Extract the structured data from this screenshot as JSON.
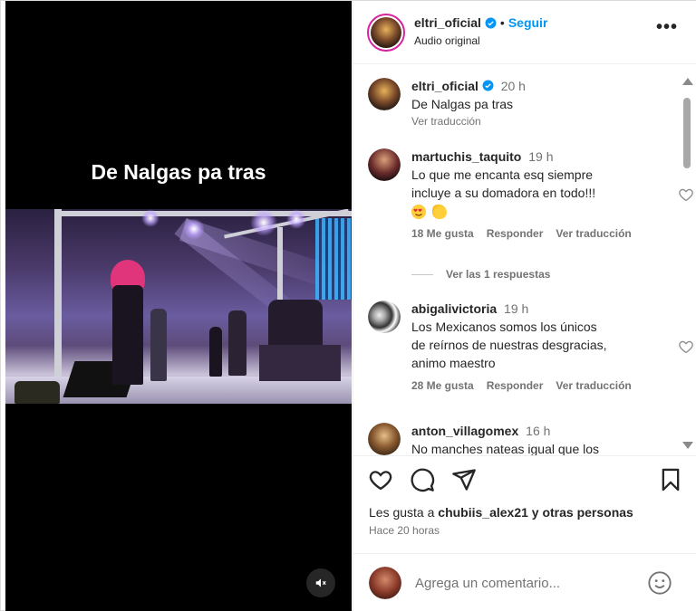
{
  "video": {
    "caption": "De Nalgas pa tras",
    "mute_icon": "speaker-muted-icon"
  },
  "header": {
    "username": "eltri_oficial",
    "separator": "•",
    "follow_label": "Seguir",
    "subtitle": "Audio original",
    "more_icon": "more-horizontal-icon",
    "more_label": "•••"
  },
  "caption_comment": {
    "username": "eltri_oficial",
    "time": "20 h",
    "text": "De Nalgas pa tras",
    "translate": "Ver traducción"
  },
  "comments": [
    {
      "username": "martuchis_taquito",
      "time": "19 h",
      "text_line1": "Lo que me encanta esq siempre",
      "text_line2": "incluye a su domadora en todo!!!",
      "likes": "18 Me gusta",
      "reply": "Responder",
      "translate": "Ver traducción",
      "view_replies": "Ver las 1 respuestas"
    },
    {
      "username": "abigalivictoria",
      "time": "19 h",
      "text_line1": "Los Mexicanos somos los únicos",
      "text_line2": "de reírnos de nuestras desgracias,",
      "text_line3": "animo maestro",
      "likes": "28 Me gusta",
      "reply": "Responder",
      "translate": "Ver traducción"
    },
    {
      "username": "anton_villagomex",
      "time": "16 h",
      "text_line1": "No manches nateas igual que los"
    }
  ],
  "actions": {
    "likes_prefix": "Les gusta a ",
    "likes_user": "chubiis_alex21",
    "likes_suffix": " y otras personas",
    "time_ago": "Hace 20 horas"
  },
  "add_comment": {
    "placeholder": "Agrega un comentario..."
  },
  "colors": {
    "accent_blue": "#0095f6",
    "text": "#262626",
    "secondary": "#737373"
  }
}
